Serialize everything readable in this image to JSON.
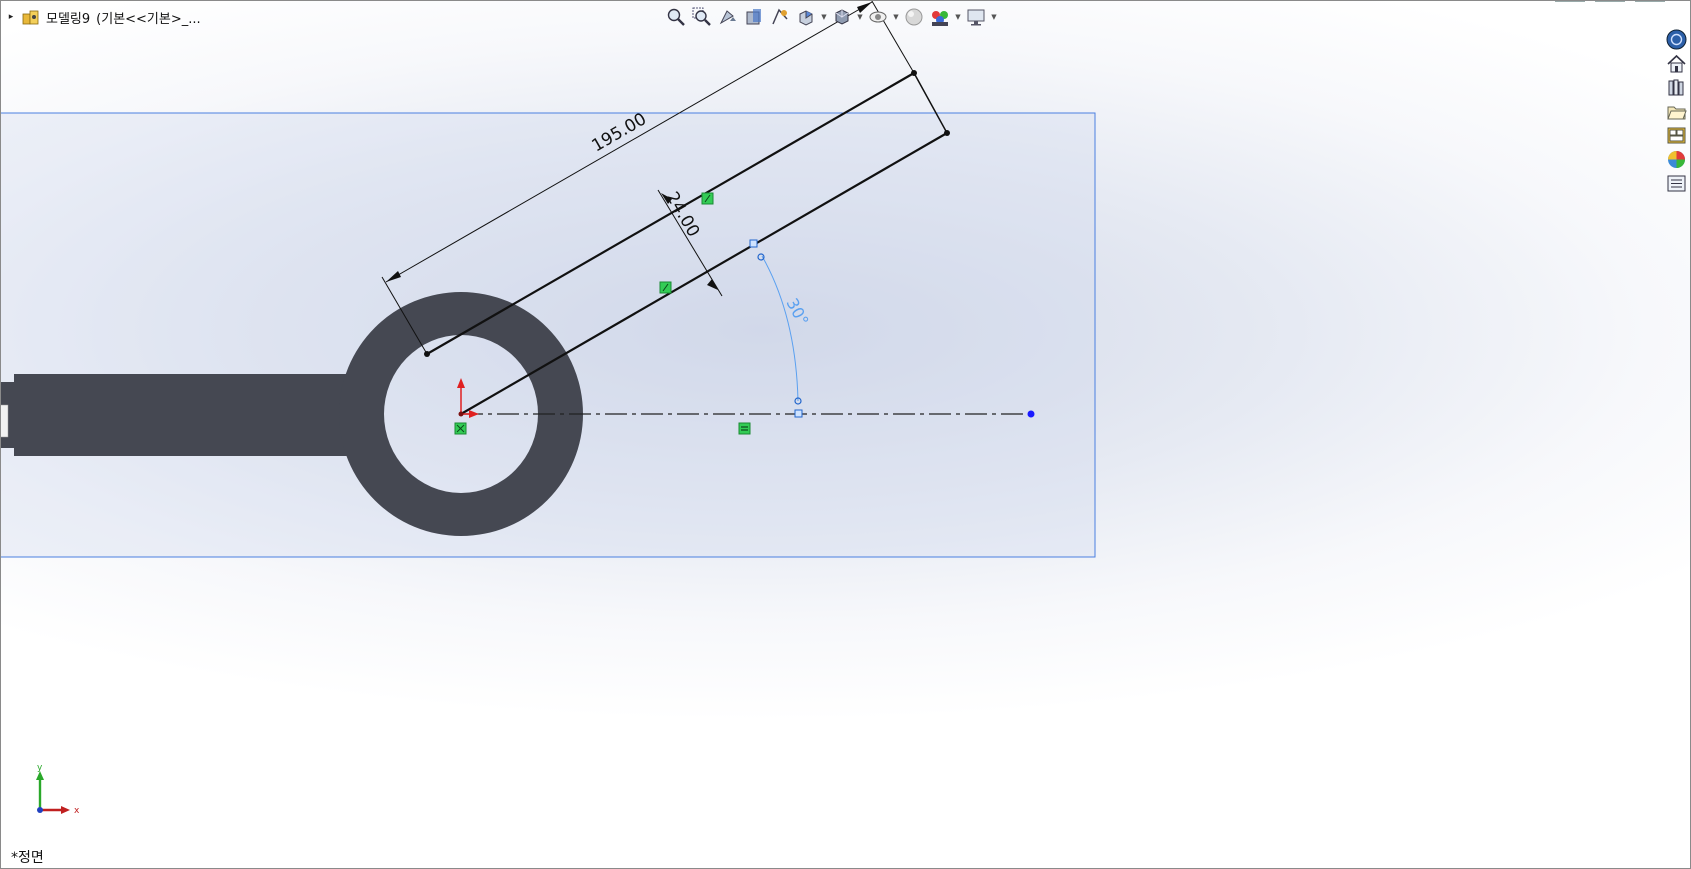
{
  "feature_tree": {
    "expand_glyph": "▸",
    "part_name": "모델링9",
    "config_label": "(기본<<기본>_..."
  },
  "toolbar": {
    "buttons": [
      {
        "icon": "zoom-to-fit-icon"
      },
      {
        "icon": "zoom-to-area-icon"
      },
      {
        "icon": "previous-view-icon"
      },
      {
        "icon": "section-view-icon"
      },
      {
        "icon": "dynamic-annotation-views-icon"
      },
      {
        "icon": "view-orientation-icon",
        "dropdown": true
      },
      {
        "icon": "display-style-icon",
        "dropdown": true
      },
      {
        "icon": "hide-show-items-icon",
        "dropdown": true
      },
      {
        "icon": "edit-appearance-icon"
      },
      {
        "icon": "apply-scene-icon",
        "dropdown": true
      },
      {
        "icon": "view-settings-icon",
        "dropdown": true
      }
    ]
  },
  "task_pane": [
    {
      "icon": "solidworks-resources-icon"
    },
    {
      "icon": "home-icon"
    },
    {
      "icon": "design-library-icon"
    },
    {
      "icon": "file-explorer-icon"
    },
    {
      "icon": "view-palette-icon"
    },
    {
      "icon": "appearances-scenes-icon"
    },
    {
      "icon": "custom-properties-icon"
    }
  ],
  "sketch": {
    "dimension_length": "195.00",
    "dimension_width": "24.00",
    "dimension_angle": "30°",
    "colors": {
      "body": "#454852",
      "sketch_line": "#111111",
      "driven_dim": "#111111",
      "angle_dim": "#5aa0f0",
      "plane_border": "#4a7fe0",
      "relation_icon": "#33cc55",
      "endpoint_blue": "#1a1aff"
    }
  },
  "triad": {
    "x_label": "x",
    "y_label": "y"
  },
  "view_name": "*정면"
}
